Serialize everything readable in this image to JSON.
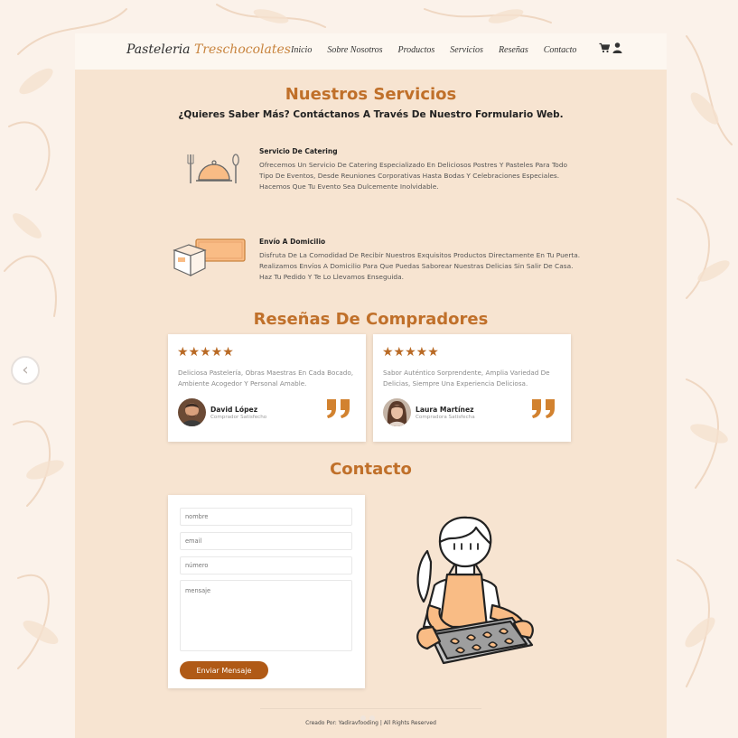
{
  "brand": {
    "name_part1": "Pasteleria",
    "name_part2": "Treschocolates"
  },
  "nav": {
    "items": [
      {
        "label": "Inicio"
      },
      {
        "label": "Sobre Nosotros"
      },
      {
        "label": "Productos"
      },
      {
        "label": "Servicios"
      },
      {
        "label": "Reseñas"
      },
      {
        "label": "Contacto"
      }
    ],
    "icons": [
      "cart-icon",
      "user-icon"
    ]
  },
  "services": {
    "title": "Nuestros Servicios",
    "subtitle_prefix": "¿Quieres Saber Más? ",
    "subtitle_rest": "Contáctanos A Través De Nuestro Formulario Web.",
    "items": [
      {
        "icon": "catering-icon",
        "title": "Servicio De Catering",
        "description": "Ofrecemos Un Servicio De Catering Especializado En Deliciosos Postres Y Pasteles Para Todo Tipo De Eventos, Desde Reuniones Corporativas Hasta Bodas Y Celebraciones Especiales. Hacemos Que Tu Evento Sea Dulcemente Inolvidable."
      },
      {
        "icon": "delivery-box-icon",
        "title": "Envío A Domicilio",
        "description": "Disfruta De La Comodidad De Recibir Nuestros Exquisitos Productos Directamente En Tu Puerta. Realizamos Envíos A Domicilio Para Que Puedas Saborear Nuestras Delicias Sin Salir De Casa. Haz Tu Pedido Y Te Lo Llevamos Enseguida."
      }
    ]
  },
  "reviews": {
    "title": "Reseñas De Compradores",
    "items": [
      {
        "stars": "★★★★★",
        "rating": 5,
        "text": "Deliciosa Pastelería, Obras Maestras En Cada Bocado, Ambiente Acogedor Y Personal Amable.",
        "name": "David López",
        "role": "Comprador Satisfecho"
      },
      {
        "stars": "★★★★★",
        "rating": 5,
        "text": "Sabor Auténtico Sorprendente, Amplia Variedad De Delicias, Siempre Una Experiencia Deliciosa.",
        "name": "Laura Martínez",
        "role": "Compradora Satisfecha"
      }
    ]
  },
  "contact": {
    "title": "Contacto",
    "fields": {
      "name_placeholder": "nombre",
      "email_placeholder": "email",
      "number_placeholder": "número",
      "message_placeholder": "mensaje"
    },
    "submit_label": "Enviar Mensaje"
  },
  "footer": {
    "text": "Creado Por: Yadiravfooding | All Rights Reserved"
  },
  "carousel": {
    "prev_label": "‹"
  },
  "colors": {
    "accent": "#c0702a",
    "button": "#b05a16",
    "panel": "#f7e4d1",
    "background": "#fbf2ea",
    "illustration_fill": "#f9bc85"
  }
}
